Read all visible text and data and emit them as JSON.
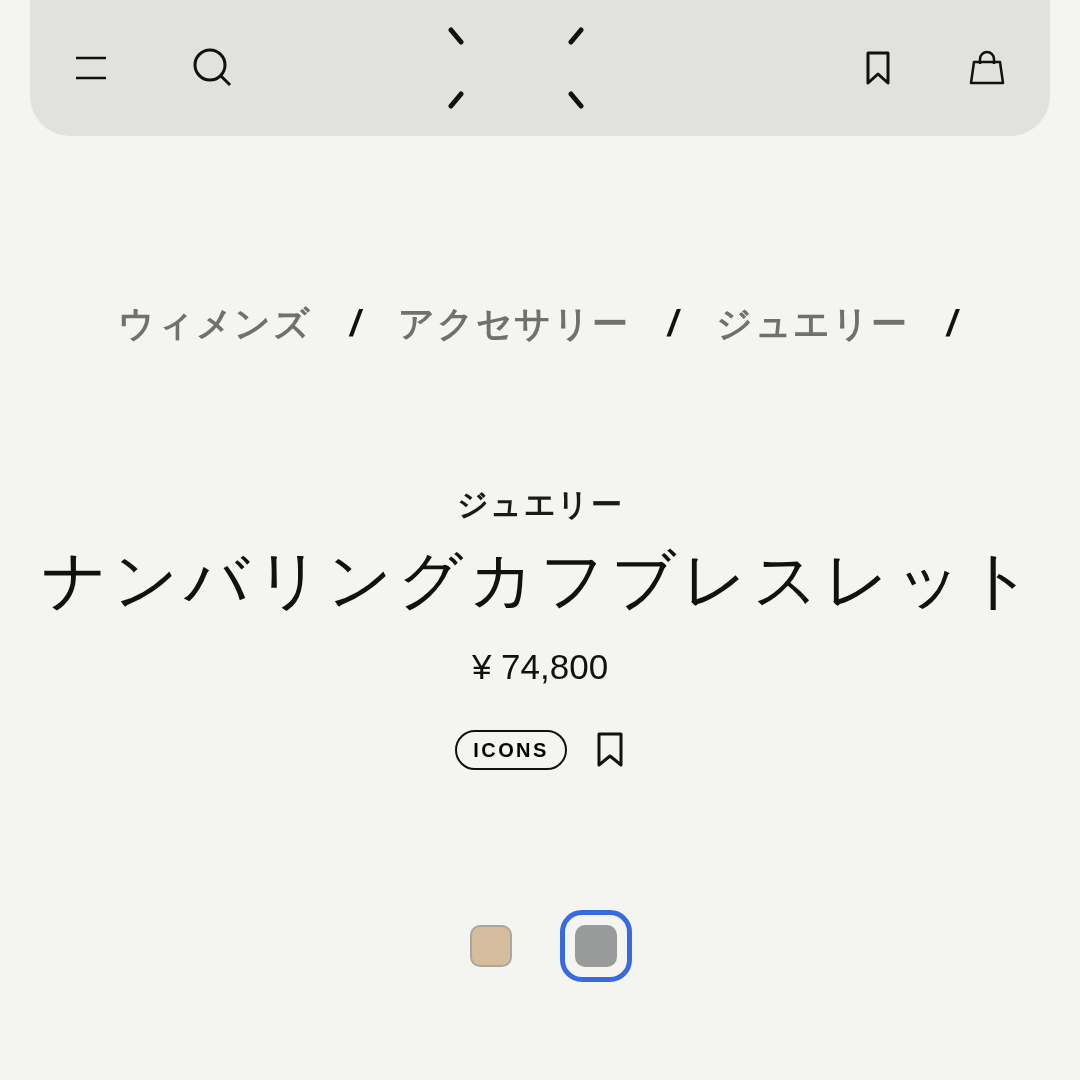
{
  "breadcrumb": {
    "items": [
      "ウィメンズ",
      "アクセサリー",
      "ジュエリー"
    ],
    "separators": [
      "/",
      "/",
      "/"
    ]
  },
  "category": "ジュエリー",
  "title": "ナンバリングカフブレスレット",
  "price": "¥ 74,800",
  "badge": "ICONS",
  "swatches": [
    {
      "color": "#d5bd9d",
      "selected": false
    },
    {
      "color": "#999b9b",
      "selected": true
    }
  ]
}
